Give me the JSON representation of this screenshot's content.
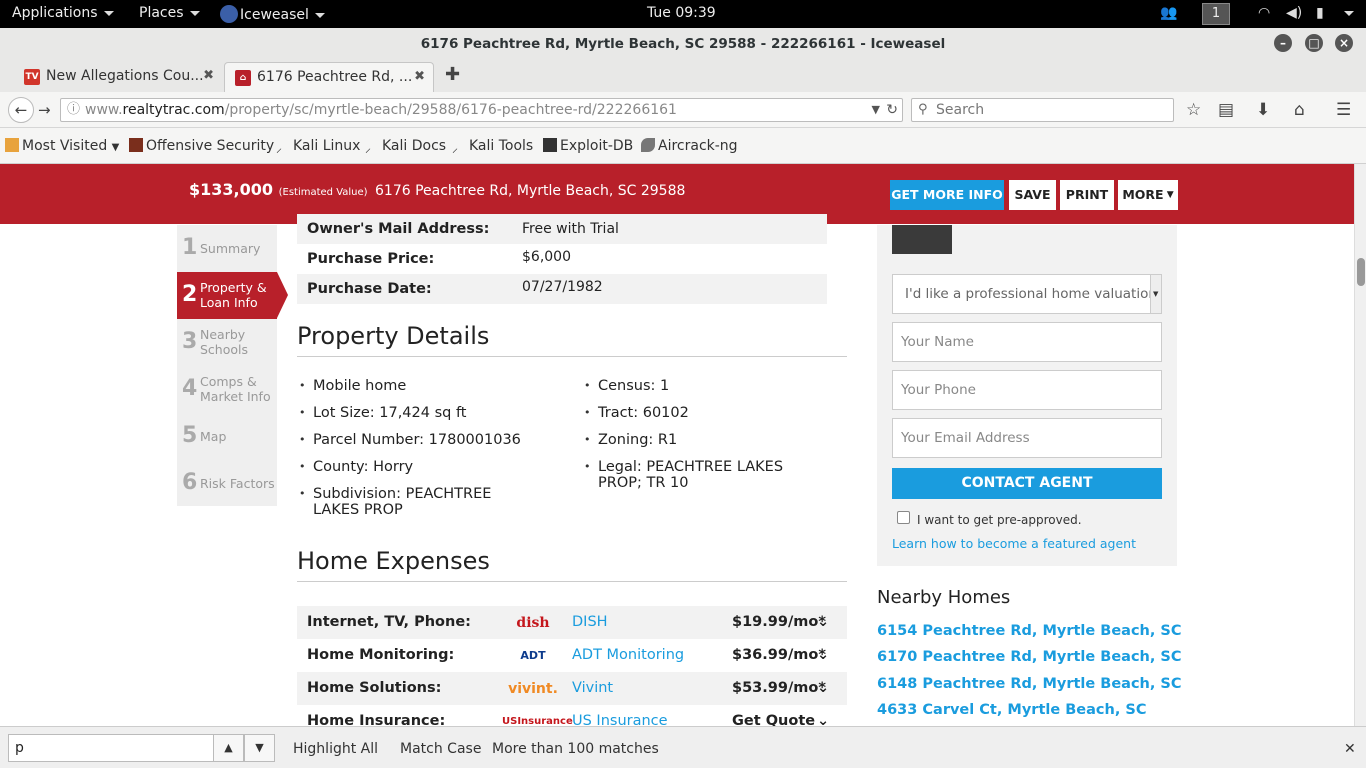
{
  "topbar": {
    "applications": "Applications",
    "places": "Places",
    "app_name": "Iceweasel",
    "clock": "Tue 09:39",
    "workspace": "1"
  },
  "window": {
    "title": "6176 Peachtree Rd, Myrtle Beach, SC 29588 - 222266161 - Iceweasel"
  },
  "tabs": [
    {
      "label": "New Allegations Cou...",
      "favicon": "TV"
    },
    {
      "label": "6176 Peachtree Rd, ...",
      "favicon": "⌂"
    }
  ],
  "nav": {
    "url_prefix": "www.",
    "url_domain": "realtytrac.com",
    "url_path": "/property/sc/myrtle-beach/29588/6176-peachtree-rd/222266161",
    "search_placeholder": "Search"
  },
  "bookmarks": [
    "Most Visited",
    "Offensive Security",
    "Kali Linux",
    "Kali Docs",
    "Kali Tools",
    "Exploit-DB",
    "Aircrack-ng"
  ],
  "redbar": {
    "price": "$133,000",
    "price_note": "(Estimated Value)",
    "address": "6176 Peachtree Rd, Myrtle Beach, SC 29588",
    "btn_info": "GET MORE INFO",
    "btn_save": "SAVE",
    "btn_print": "PRINT",
    "btn_more": "MORE"
  },
  "steps": [
    {
      "num": "1",
      "label": "Summary"
    },
    {
      "num": "2",
      "label": "Property & Loan Info"
    },
    {
      "num": "3",
      "label": "Nearby Schools"
    },
    {
      "num": "4",
      "label": "Comps & Market Info"
    },
    {
      "num": "5",
      "label": "Map"
    },
    {
      "num": "6",
      "label": "Risk Factors"
    }
  ],
  "owner_table": [
    {
      "key": "Owner's Mail Address:",
      "value": "Free with Trial"
    },
    {
      "key": "Purchase Price:",
      "value": "$6,000"
    },
    {
      "key": "Purchase Date:",
      "value": "07/27/1982"
    }
  ],
  "property_details": {
    "heading": "Property Details",
    "left": [
      "Mobile home",
      "Lot Size: 17,424 sq ft",
      "Parcel Number: 1780001036",
      "County: Horry",
      "Subdivision: PEACHTREE LAKES PROP"
    ],
    "right": [
      "Census: 1",
      "Tract: 60102",
      "Zoning: R1",
      "Legal: PEACHTREE LAKES PROP; TR 10"
    ]
  },
  "home_expenses": {
    "heading": "Home Expenses",
    "rows": [
      {
        "key": "Internet, TV, Phone:",
        "logo": "dish",
        "provider": "DISH",
        "cost": "$19.99/mo*"
      },
      {
        "key": "Home Monitoring:",
        "logo": "ADT",
        "provider": "ADT Monitoring",
        "cost": "$36.99/mo*"
      },
      {
        "key": "Home Solutions:",
        "logo": "vivint.",
        "provider": "Vivint",
        "cost": "$53.99/mo*"
      },
      {
        "key": "Home Insurance:",
        "logo": "USInsurance",
        "provider": "US Insurance",
        "cost": "Get Quote"
      }
    ]
  },
  "agent_form": {
    "select_value": "I'd like a professional home valuation",
    "name_placeholder": "Your Name",
    "phone_placeholder": "Your Phone",
    "email_placeholder": "Your Email Address",
    "contact_btn": "CONTACT AGENT",
    "preapproved": "I want to get pre-approved.",
    "featured_link": "Learn how to become a featured agent"
  },
  "nearby": {
    "heading": "Nearby Homes",
    "homes": [
      "6154 Peachtree Rd, Myrtle Beach, SC",
      "6170 Peachtree Rd, Myrtle Beach, SC",
      "6148 Peachtree Rd, Myrtle Beach, SC",
      "4633 Carvel Ct, Myrtle Beach, SC"
    ]
  },
  "findbar": {
    "query": "p",
    "highlight_all": "Highlight All",
    "match_case": "Match Case",
    "status": "More than 100 matches"
  }
}
